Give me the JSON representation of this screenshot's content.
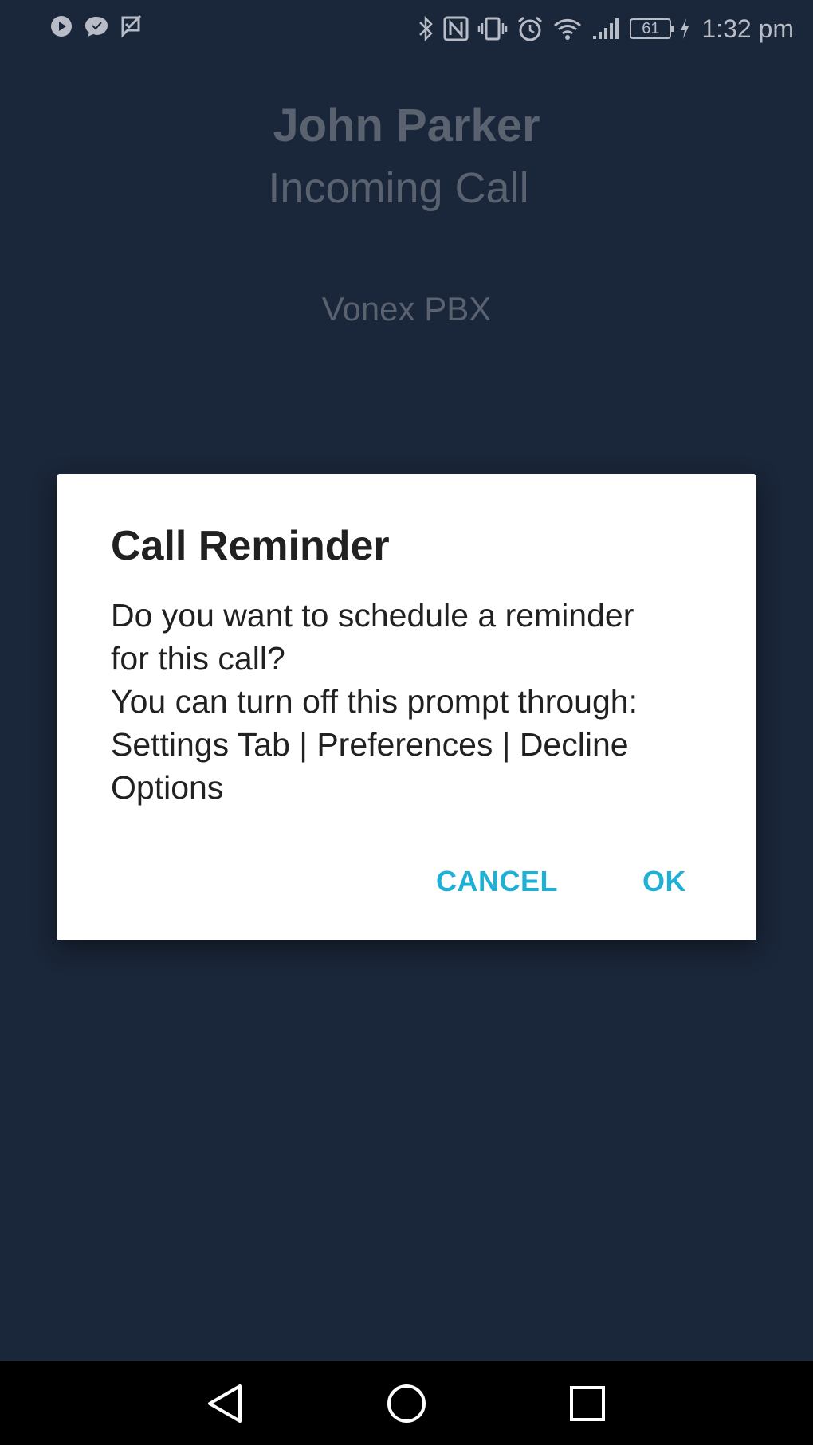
{
  "status_bar": {
    "left_icons": [
      "play-notification-icon",
      "chat-notification-icon",
      "task-notification-icon"
    ],
    "right_icons": [
      "bluetooth-icon",
      "nfc-icon",
      "vibrate-icon",
      "alarm-icon",
      "wifi-icon",
      "signal-icon"
    ],
    "battery_level": "61",
    "charging_icon": "charging-bolt-icon",
    "time": "1:32 pm"
  },
  "call_screen": {
    "caller_name": "John Parker",
    "call_state": "Incoming Call",
    "pbx_name": "Vonex PBX"
  },
  "dialog": {
    "title": "Call Reminder",
    "message_lines": [
      "Do you want to schedule a reminder",
      "for this call?",
      "You can turn off this prompt through:",
      "Settings Tab | Preferences | Decline",
      "Options"
    ],
    "cancel_label": "CANCEL",
    "ok_label": "OK",
    "accent_color": "#1fb0d6"
  },
  "nav_bar": {
    "buttons": [
      "back-icon",
      "home-icon",
      "recents-icon"
    ]
  }
}
